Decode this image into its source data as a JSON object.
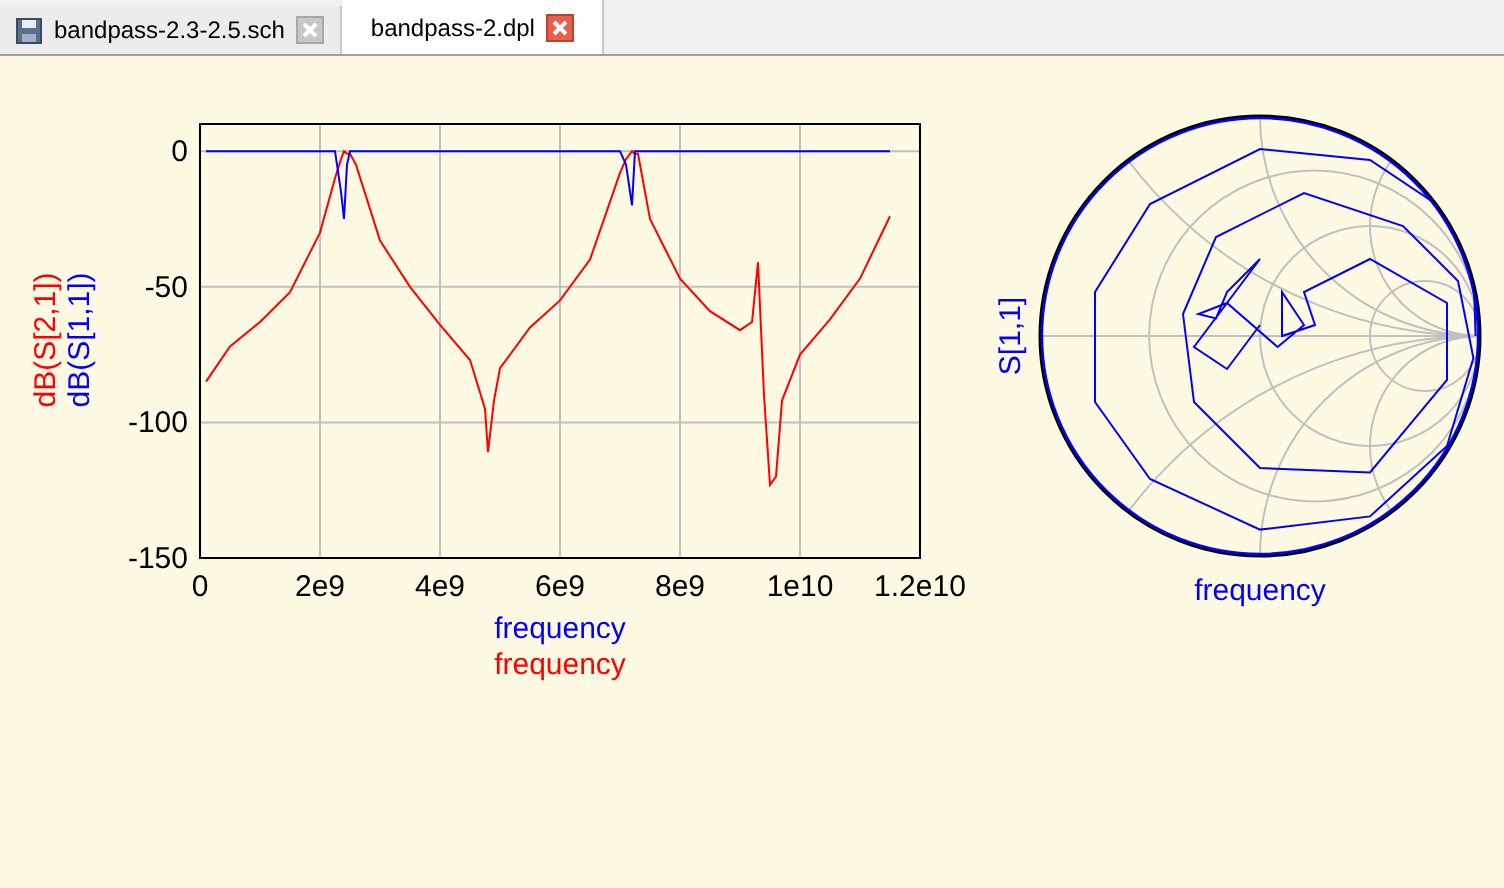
{
  "tabs": [
    {
      "label": "bandpass-2.3-2.5.sch",
      "kind": "schematic",
      "selected": false
    },
    {
      "label": "bandpass-2.dpl",
      "kind": "display",
      "selected": true
    }
  ],
  "cartesian_plot": {
    "x_labels": [
      {
        "text": "frequency",
        "color": "#0000ff"
      },
      {
        "text": "frequency",
        "color": "#ff0000"
      }
    ],
    "chart_data": {
      "type": "line",
      "grid": true,
      "xlim": [
        0,
        12000000000.0
      ],
      "ylim": [
        -150,
        10
      ],
      "xticks": [
        {
          "value": 0,
          "label": "0"
        },
        {
          "value": 2000000000.0,
          "label": "2e9"
        },
        {
          "value": 4000000000.0,
          "label": "4e9"
        },
        {
          "value": 6000000000.0,
          "label": "6e9"
        },
        {
          "value": 8000000000.0,
          "label": "8e9"
        },
        {
          "value": 10000000000.0,
          "label": "1e10"
        },
        {
          "value": 12000000000.0,
          "label": "1.2e10"
        }
      ],
      "yticks": [
        0,
        -50,
        -100,
        -150
      ],
      "x": [
        100000000.0,
        500000000.0,
        1000000000.0,
        1500000000.0,
        2000000000.0,
        2250000000.0,
        2350000000.0,
        2400000000.0,
        2450000000.0,
        2500000000.0,
        2600000000.0,
        3000000000.0,
        3500000000.0,
        4000000000.0,
        4500000000.0,
        4750000000.0,
        4800000000.0,
        4900000000.0,
        5000000000.0,
        5500000000.0,
        6000000000.0,
        6500000000.0,
        7000000000.0,
        7100000000.0,
        7200000000.0,
        7250000000.0,
        7300000000.0,
        7500000000.0,
        8000000000.0,
        8500000000.0,
        9000000000.0,
        9200000000.0,
        9300000000.0,
        9400000000.0,
        9500000000.0,
        9600000000.0,
        9700000000.0,
        10000000000.0,
        10500000000.0,
        11000000000.0,
        11500000000.0
      ],
      "series": [
        {
          "name": "dB(S[2,1])",
          "color": "#ff0000",
          "values": [
            -85,
            -72,
            -63,
            -52,
            -30,
            -10,
            -3,
            0,
            -1,
            -1,
            -5,
            -33,
            -50,
            -64,
            -77,
            -95,
            -111,
            -92,
            -80,
            -65,
            -55,
            -40,
            -8,
            -3,
            0,
            -1,
            -1,
            -25,
            -47,
            -59,
            -66,
            -63,
            -41,
            -90,
            -123,
            -120,
            -92,
            -75,
            -62,
            -47,
            -24
          ]
        },
        {
          "name": "dB(S[1,1])",
          "color": "#0000ff",
          "values": [
            0,
            0,
            0,
            0,
            0,
            0,
            -15,
            -25,
            -5,
            0,
            0,
            0,
            0,
            0,
            0,
            0,
            0,
            0,
            0,
            0,
            0,
            0,
            0,
            -5,
            -20,
            0,
            0,
            0,
            0,
            0,
            0,
            0,
            0,
            0,
            0,
            0,
            0,
            0,
            0,
            0,
            0
          ]
        }
      ]
    }
  },
  "smith_chart": {
    "trace_label": "S[1,1]",
    "x_label": "frequency"
  }
}
